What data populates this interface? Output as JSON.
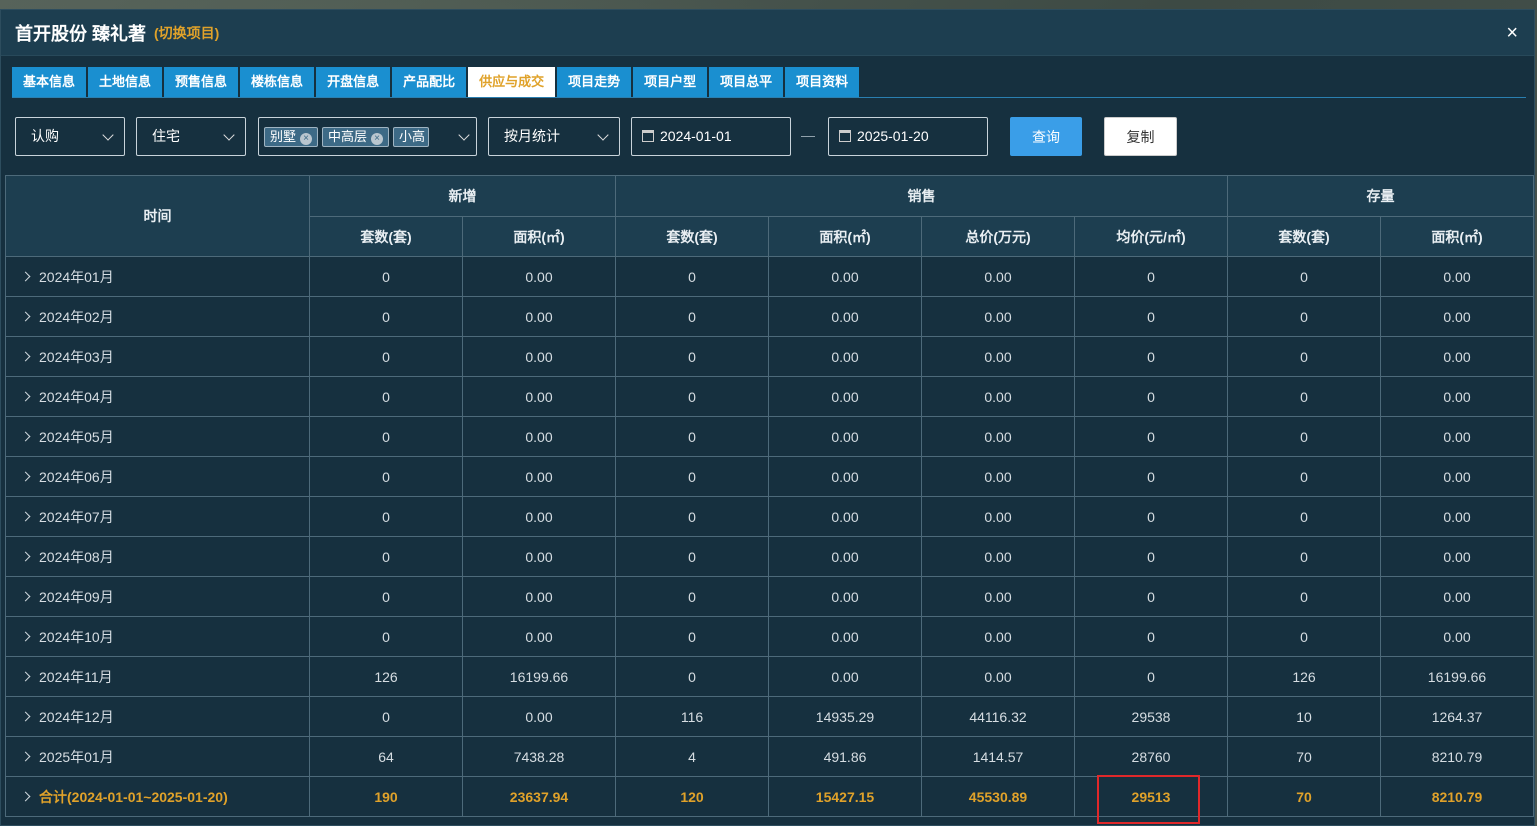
{
  "window": {
    "title": "首开股份 臻礼著",
    "switch_label": "(切换项目)",
    "close_label": "×"
  },
  "tabs": [
    {
      "label": "基本信息",
      "active": false
    },
    {
      "label": "土地信息",
      "active": false
    },
    {
      "label": "预售信息",
      "active": false
    },
    {
      "label": "楼栋信息",
      "active": false
    },
    {
      "label": "开盘信息",
      "active": false
    },
    {
      "label": "产品配比",
      "active": false
    },
    {
      "label": "供应与成交",
      "active": true
    },
    {
      "label": "项目走势",
      "active": false
    },
    {
      "label": "项目户型",
      "active": false
    },
    {
      "label": "项目总平",
      "active": false
    },
    {
      "label": "项目资料",
      "active": false
    }
  ],
  "filters": {
    "status_select": "认购",
    "type_select": "住宅",
    "product_tags": [
      "别墅",
      "中高层",
      "小高"
    ],
    "period_select": "按月统计",
    "start_date": "2024-01-01",
    "date_separator": "—",
    "end_date": "2025-01-20",
    "query_label": "查询",
    "copy_label": "复制"
  },
  "table": {
    "time_header": "时间",
    "groups": [
      "新增",
      "销售",
      "存量"
    ],
    "columns": [
      "套数(套)",
      "面积(㎡)",
      "套数(套)",
      "面积(㎡)",
      "总价(万元)",
      "均价(元/㎡)",
      "套数(套)",
      "面积(㎡)"
    ],
    "rows": [
      {
        "time": "2024年01月",
        "values": [
          "0",
          "0.00",
          "0",
          "0.00",
          "0.00",
          "0",
          "0",
          "0.00"
        ]
      },
      {
        "time": "2024年02月",
        "values": [
          "0",
          "0.00",
          "0",
          "0.00",
          "0.00",
          "0",
          "0",
          "0.00"
        ]
      },
      {
        "time": "2024年03月",
        "values": [
          "0",
          "0.00",
          "0",
          "0.00",
          "0.00",
          "0",
          "0",
          "0.00"
        ]
      },
      {
        "time": "2024年04月",
        "values": [
          "0",
          "0.00",
          "0",
          "0.00",
          "0.00",
          "0",
          "0",
          "0.00"
        ]
      },
      {
        "time": "2024年05月",
        "values": [
          "0",
          "0.00",
          "0",
          "0.00",
          "0.00",
          "0",
          "0",
          "0.00"
        ]
      },
      {
        "time": "2024年06月",
        "values": [
          "0",
          "0.00",
          "0",
          "0.00",
          "0.00",
          "0",
          "0",
          "0.00"
        ]
      },
      {
        "time": "2024年07月",
        "values": [
          "0",
          "0.00",
          "0",
          "0.00",
          "0.00",
          "0",
          "0",
          "0.00"
        ]
      },
      {
        "time": "2024年08月",
        "values": [
          "0",
          "0.00",
          "0",
          "0.00",
          "0.00",
          "0",
          "0",
          "0.00"
        ]
      },
      {
        "time": "2024年09月",
        "values": [
          "0",
          "0.00",
          "0",
          "0.00",
          "0.00",
          "0",
          "0",
          "0.00"
        ]
      },
      {
        "time": "2024年10月",
        "values": [
          "0",
          "0.00",
          "0",
          "0.00",
          "0.00",
          "0",
          "0",
          "0.00"
        ]
      },
      {
        "time": "2024年11月",
        "values": [
          "126",
          "16199.66",
          "0",
          "0.00",
          "0.00",
          "0",
          "126",
          "16199.66"
        ]
      },
      {
        "time": "2024年12月",
        "values": [
          "0",
          "0.00",
          "116",
          "14935.29",
          "44116.32",
          "29538",
          "10",
          "1264.37"
        ]
      },
      {
        "time": "2025年01月",
        "values": [
          "64",
          "7438.28",
          "4",
          "491.86",
          "1414.57",
          "28760",
          "70",
          "8210.79"
        ]
      }
    ],
    "total": {
      "time": "合计(2024-01-01~2025-01-20)",
      "values": [
        "190",
        "23637.94",
        "120",
        "15427.15",
        "45530.89",
        "29513",
        "70",
        "8210.79"
      ]
    }
  },
  "colors": {
    "accent": "#e0a22a",
    "tab_bg": "#1a8fd0",
    "highlight_box": "#e0282a"
  }
}
